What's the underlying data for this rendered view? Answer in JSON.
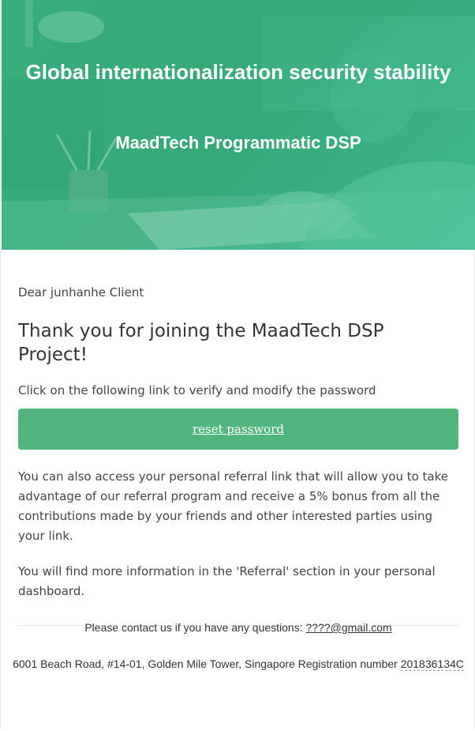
{
  "hero": {
    "title": "Global internationalization security stability",
    "subtitle": "MaadTech Programmatic DSP"
  },
  "email": {
    "greeting": "Dear junhanhe Client",
    "headline": "Thank you for joining the MaadTech DSP Project!",
    "instruction": "Click on the following link to verify and modify the password",
    "reset_label": "reset password",
    "referral_paragraph": "You can also access your personal referral link that will allow you to take advantage of our referral program and receive a 5% bonus from all the contributions made by your friends and other interested parties using your link.",
    "info_paragraph": "You will find more information in the 'Referral' section in your personal dashboard."
  },
  "footer": {
    "contact_text": "Please contact us if you have any questions: ",
    "contact_email": "????@gmail.com",
    "address_text": "6001 Beach Road, #14-01, Golden Mile Tower, Singapore Registration number ",
    "registration_number": "201836134C"
  },
  "colors": {
    "hero_green": "#37b07f",
    "button_green": "#52b57e"
  }
}
